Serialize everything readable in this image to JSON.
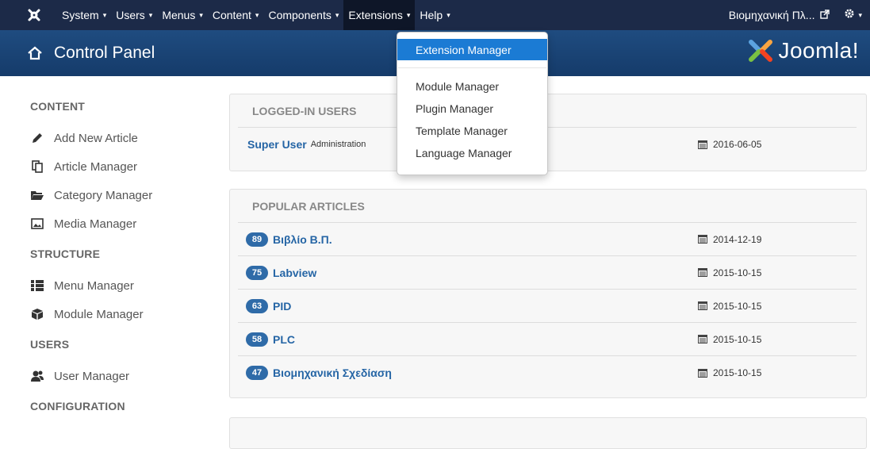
{
  "navbar": {
    "menu": [
      {
        "label": "System",
        "key": "system"
      },
      {
        "label": "Users",
        "key": "users"
      },
      {
        "label": "Menus",
        "key": "menus"
      },
      {
        "label": "Content",
        "key": "content"
      },
      {
        "label": "Components",
        "key": "components"
      },
      {
        "label": "Extensions",
        "key": "extensions"
      },
      {
        "label": "Help",
        "key": "help"
      }
    ],
    "caret": "▾",
    "site_name": "Βιομηχανική Πλ...",
    "external_icon": "external-link-icon",
    "gear_icon": "gear-icon"
  },
  "header": {
    "title": "Control Panel",
    "brand": "Joomla!"
  },
  "sidebar": {
    "sections": [
      {
        "heading": "CONTENT",
        "items": [
          "Add New Article",
          "Article Manager",
          "Category Manager",
          "Media Manager"
        ]
      },
      {
        "heading": "STRUCTURE",
        "items": [
          "Menu Manager",
          "Module Manager"
        ]
      },
      {
        "heading": "USERS",
        "items": [
          "User Manager"
        ]
      },
      {
        "heading": "CONFIGURATION",
        "items": []
      }
    ]
  },
  "logged_in": {
    "title": "LOGGED-IN USERS",
    "rows": [
      {
        "name": "Super User",
        "sub": "Administration",
        "date": "2016-06-05"
      }
    ]
  },
  "popular": {
    "title": "POPULAR ARTICLES",
    "rows": [
      {
        "hits": "89",
        "title": "Βιβλίο Β.Π.",
        "date": "2014-12-19"
      },
      {
        "hits": "75",
        "title": "Labview",
        "date": "2015-10-15"
      },
      {
        "hits": "63",
        "title": "PID",
        "date": "2015-10-15"
      },
      {
        "hits": "58",
        "title": "PLC",
        "date": "2015-10-15"
      },
      {
        "hits": "47",
        "title": "Βιομηχανική Σχεδίαση",
        "date": "2015-10-15"
      }
    ]
  },
  "dropdown": {
    "active": "Extension Manager",
    "items": [
      "Module Manager",
      "Plugin Manager",
      "Template Manager",
      "Language Manager"
    ]
  },
  "colors": {
    "navbar": "#1c2a48",
    "header": "#1f4c80",
    "link": "#2565a5",
    "badge": "#2f6ba8",
    "dropdown_active": "#1b7bd4"
  }
}
